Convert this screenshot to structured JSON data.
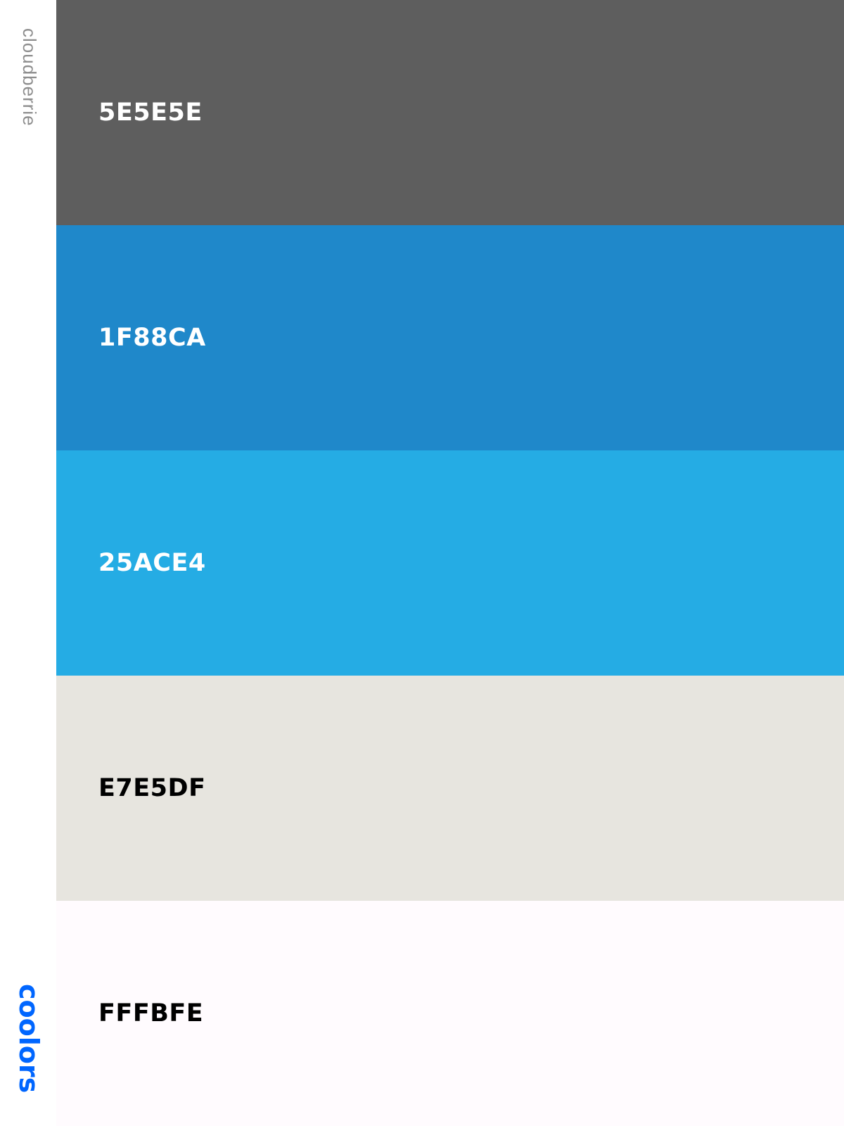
{
  "sidebar": {
    "palette_name": "cloudberrie",
    "brand": "coolors",
    "brand_color": "#0066ff",
    "name_color": "#8d8d8d"
  },
  "swatches": [
    {
      "hex": "5E5E5E",
      "color": "#5E5E5E",
      "text_color": "#ffffff"
    },
    {
      "hex": "1F88CA",
      "color": "#1F88CA",
      "text_color": "#ffffff"
    },
    {
      "hex": "25ACE4",
      "color": "#25ACE4",
      "text_color": "#ffffff"
    },
    {
      "hex": "E7E5DF",
      "color": "#E7E5DF",
      "text_color": "#000000"
    },
    {
      "hex": "FFFBFE",
      "color": "#FFFBFE",
      "text_color": "#000000"
    }
  ]
}
